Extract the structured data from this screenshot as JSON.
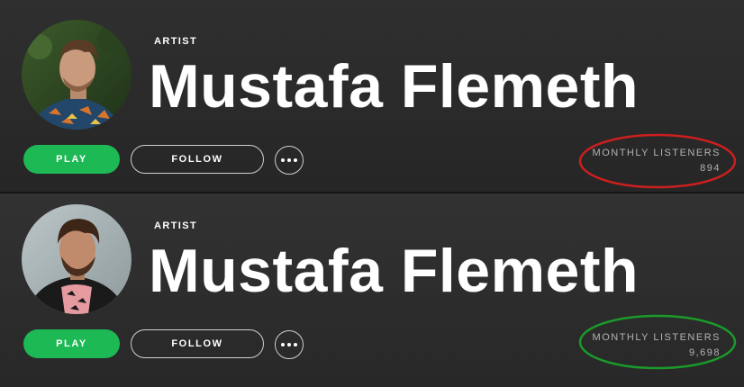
{
  "profiles": [
    {
      "type_label": "ARTIST",
      "name": "Mustafa Flemeth",
      "play_label": "PLAY",
      "follow_label": "FOLLOW",
      "monthly_listeners_label": "MONTHLY LISTENERS",
      "monthly_listeners_value": "894",
      "highlight_color": "#cc1f1f"
    },
    {
      "type_label": "ARTIST",
      "name": "Mustafa Flemeth",
      "play_label": "PLAY",
      "follow_label": "FOLLOW",
      "monthly_listeners_label": "MONTHLY LISTENERS",
      "monthly_listeners_value": "9,698",
      "highlight_color": "#1a9a2a"
    }
  ],
  "theme": {
    "play_button_color": "#1db954"
  }
}
